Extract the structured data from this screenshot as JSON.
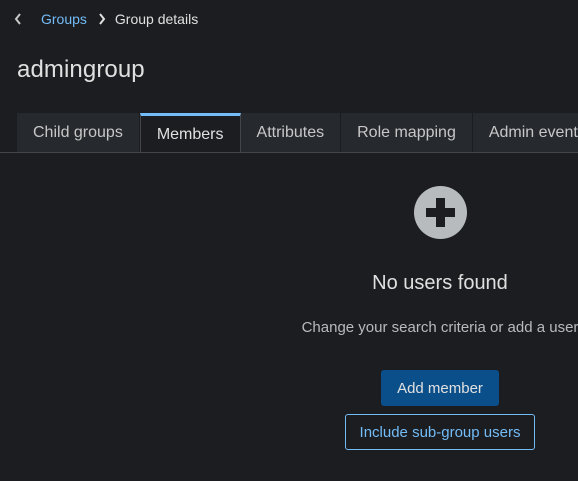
{
  "breadcrumb": {
    "back_icon": "chevron-left-icon",
    "parent_label": "Groups",
    "separator_icon": "chevron-right-icon",
    "current_label": "Group details"
  },
  "page": {
    "title": "admingroup"
  },
  "tabs": [
    {
      "label": "Child groups",
      "active": false
    },
    {
      "label": "Members",
      "active": true
    },
    {
      "label": "Attributes",
      "active": false
    },
    {
      "label": "Role mapping",
      "active": false
    },
    {
      "label": "Admin events",
      "active": false
    }
  ],
  "empty_state": {
    "icon": "plus-circle-icon",
    "title": "No users found",
    "body": "Change your search criteria or add a user",
    "primary_button": "Add member",
    "secondary_button": "Include sub-group users"
  },
  "colors": {
    "background": "#1b1d21",
    "link": "#73bcf7",
    "primary_button": "#0b4f8a",
    "tab_inactive_bg": "#26292d",
    "icon_fill": "#b8bbbe"
  }
}
